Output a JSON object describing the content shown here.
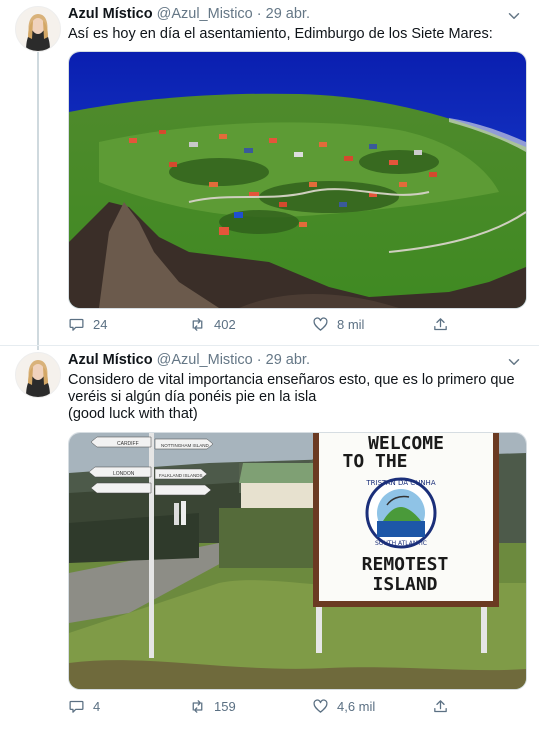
{
  "tweets": [
    {
      "name": "Azul Místico",
      "handle": "@Azul_Mistico",
      "separator": "·",
      "date": "29 abr.",
      "text_lines": [
        "Así es hoy en día el asentamiento, Edimburgo de los Siete Mares:"
      ],
      "media_alt": "Aerial view of the settlement",
      "replies": "24",
      "retweets": "402",
      "likes": "8 mil"
    },
    {
      "name": "Azul Místico",
      "handle": "@Azul_Mistico",
      "separator": "·",
      "date": "29 abr.",
      "text_lines": [
        "Considero de vital importancia enseñaros esto, que es lo primero que",
        "veréis si algún día ponéis pie en la isla",
        "(good luck with that)"
      ],
      "media_alt": "Welcome sign",
      "sign": {
        "line1": "WELCOME",
        "line2": "TO THE",
        "seal_top": "TRISTAN DA CUNHA",
        "seal_bottom": "SOUTH ATLANTIC",
        "line3": "REMOTEST",
        "line4": "ISLAND"
      },
      "signpost": [
        "CARDIFF",
        "NOTTINGHAM ISLAND",
        "LONDON",
        "FALKLAND ISLANDS"
      ],
      "replies": "4",
      "retweets": "159",
      "likes": "4,6 mil"
    }
  ]
}
